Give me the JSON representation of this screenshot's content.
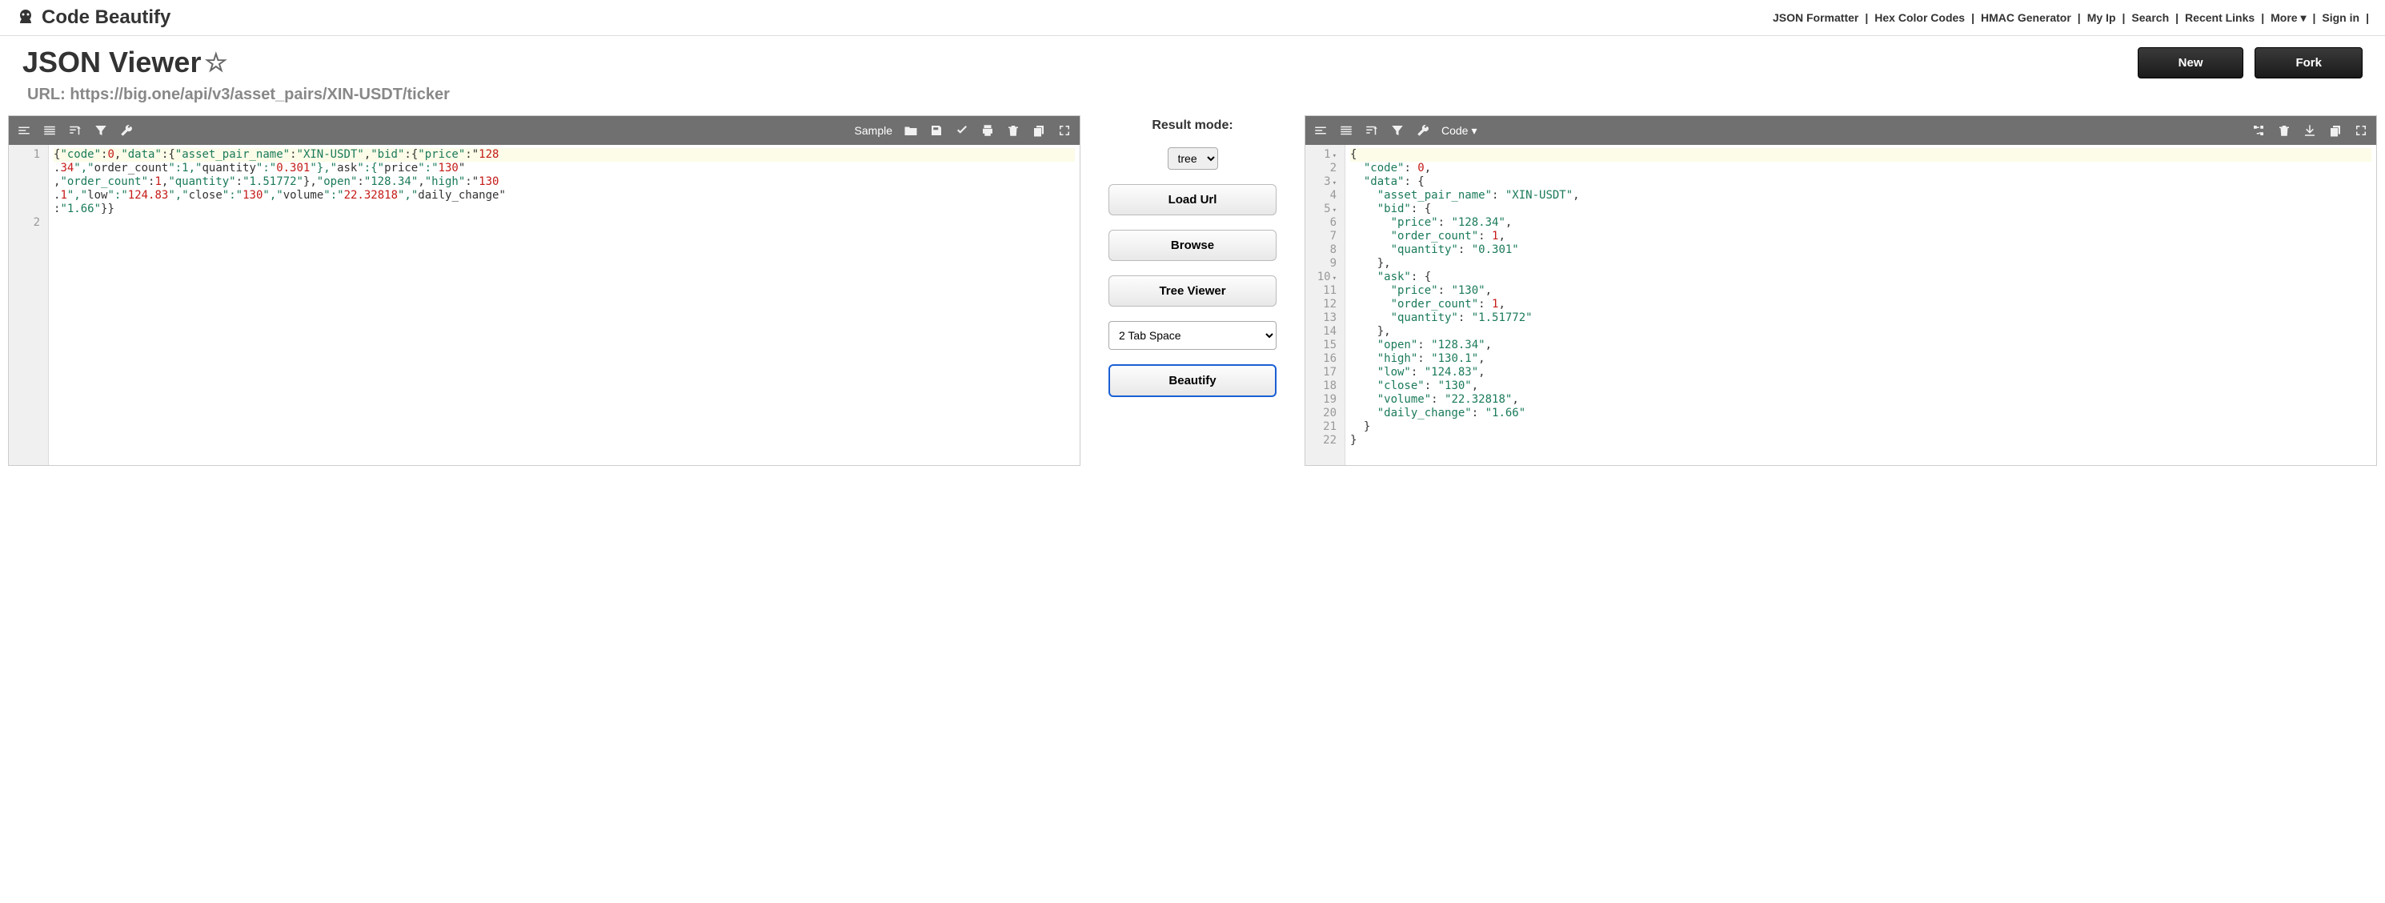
{
  "header": {
    "logo_text": "Code Beautify",
    "nav": [
      "JSON Formatter",
      "Hex Color Codes",
      "HMAC Generator",
      "My Ip",
      "Search",
      "Recent Links",
      "More",
      "Sign in"
    ]
  },
  "title": {
    "text": "JSON Viewer",
    "url_label": "URL: https://big.one/api/v3/asset_pairs/XIN-USDT/ticker",
    "new_btn": "New",
    "fork_btn": "Fork"
  },
  "center": {
    "result_mode_label": "Result mode:",
    "result_mode_value": "tree",
    "load_url": "Load Url",
    "browse": "Browse",
    "tree_viewer": "Tree Viewer",
    "indent": "2 Tab Space",
    "beautify": "Beautify"
  },
  "left_toolbar": {
    "sample": "Sample"
  },
  "right_toolbar": {
    "code": "Code"
  },
  "json_data": {
    "code": 0,
    "data": {
      "asset_pair_name": "XIN-USDT",
      "bid": {
        "price": "128.34",
        "order_count": 1,
        "quantity": "0.301"
      },
      "ask": {
        "price": "130",
        "order_count": 1,
        "quantity": "1.51772"
      },
      "open": "128.34",
      "high": "130.1",
      "low": "124.83",
      "close": "130",
      "volume": "22.32818",
      "daily_change": "1.66"
    }
  },
  "left_raw_lines": [
    "{\"code\":0,\"data\":{\"asset_pair_name\":\"XIN-USDT\",\"bid\":{\"price\":\"128",
    ".34\",\"order_count\":1,\"quantity\":\"0.301\"},\"ask\":{\"price\":\"130\"",
    ",\"order_count\":1,\"quantity\":\"1.51772\"},\"open\":\"128.34\",\"high\":\"130",
    ".1\",\"low\":\"124.83\",\"close\":\"130\",\"volume\":\"22.32818\",\"daily_change\"",
    ":\"1.66\"}}"
  ],
  "right_lines": [
    {
      "n": "1",
      "fold": true,
      "indent": 0,
      "tokens": [
        {
          "t": "punc",
          "v": "{"
        }
      ]
    },
    {
      "n": "2",
      "indent": 1,
      "tokens": [
        {
          "t": "key",
          "v": "\"code\""
        },
        {
          "t": "punc",
          "v": ": "
        },
        {
          "t": "num",
          "v": "0"
        },
        {
          "t": "punc",
          "v": ","
        }
      ]
    },
    {
      "n": "3",
      "fold": true,
      "indent": 1,
      "tokens": [
        {
          "t": "key",
          "v": "\"data\""
        },
        {
          "t": "punc",
          "v": ": {"
        }
      ]
    },
    {
      "n": "4",
      "indent": 2,
      "tokens": [
        {
          "t": "key",
          "v": "\"asset_pair_name\""
        },
        {
          "t": "punc",
          "v": ": "
        },
        {
          "t": "str",
          "v": "\"XIN-USDT\""
        },
        {
          "t": "punc",
          "v": ","
        }
      ]
    },
    {
      "n": "5",
      "fold": true,
      "indent": 2,
      "tokens": [
        {
          "t": "key",
          "v": "\"bid\""
        },
        {
          "t": "punc",
          "v": ": {"
        }
      ]
    },
    {
      "n": "6",
      "indent": 3,
      "tokens": [
        {
          "t": "key",
          "v": "\"price\""
        },
        {
          "t": "punc",
          "v": ": "
        },
        {
          "t": "str",
          "v": "\"128.34\""
        },
        {
          "t": "punc",
          "v": ","
        }
      ]
    },
    {
      "n": "7",
      "indent": 3,
      "tokens": [
        {
          "t": "key",
          "v": "\"order_count\""
        },
        {
          "t": "punc",
          "v": ": "
        },
        {
          "t": "num",
          "v": "1"
        },
        {
          "t": "punc",
          "v": ","
        }
      ]
    },
    {
      "n": "8",
      "indent": 3,
      "tokens": [
        {
          "t": "key",
          "v": "\"quantity\""
        },
        {
          "t": "punc",
          "v": ": "
        },
        {
          "t": "str",
          "v": "\"0.301\""
        }
      ]
    },
    {
      "n": "9",
      "indent": 2,
      "tokens": [
        {
          "t": "punc",
          "v": "},"
        }
      ]
    },
    {
      "n": "10",
      "fold": true,
      "indent": 2,
      "tokens": [
        {
          "t": "key",
          "v": "\"ask\""
        },
        {
          "t": "punc",
          "v": ": {"
        }
      ]
    },
    {
      "n": "11",
      "indent": 3,
      "tokens": [
        {
          "t": "key",
          "v": "\"price\""
        },
        {
          "t": "punc",
          "v": ": "
        },
        {
          "t": "str",
          "v": "\"130\""
        },
        {
          "t": "punc",
          "v": ","
        }
      ]
    },
    {
      "n": "12",
      "indent": 3,
      "tokens": [
        {
          "t": "key",
          "v": "\"order_count\""
        },
        {
          "t": "punc",
          "v": ": "
        },
        {
          "t": "num",
          "v": "1"
        },
        {
          "t": "punc",
          "v": ","
        }
      ]
    },
    {
      "n": "13",
      "indent": 3,
      "tokens": [
        {
          "t": "key",
          "v": "\"quantity\""
        },
        {
          "t": "punc",
          "v": ": "
        },
        {
          "t": "str",
          "v": "\"1.51772\""
        }
      ]
    },
    {
      "n": "14",
      "indent": 2,
      "tokens": [
        {
          "t": "punc",
          "v": "},"
        }
      ]
    },
    {
      "n": "15",
      "indent": 2,
      "tokens": [
        {
          "t": "key",
          "v": "\"open\""
        },
        {
          "t": "punc",
          "v": ": "
        },
        {
          "t": "str",
          "v": "\"128.34\""
        },
        {
          "t": "punc",
          "v": ","
        }
      ]
    },
    {
      "n": "16",
      "indent": 2,
      "tokens": [
        {
          "t": "key",
          "v": "\"high\""
        },
        {
          "t": "punc",
          "v": ": "
        },
        {
          "t": "str",
          "v": "\"130.1\""
        },
        {
          "t": "punc",
          "v": ","
        }
      ]
    },
    {
      "n": "17",
      "indent": 2,
      "tokens": [
        {
          "t": "key",
          "v": "\"low\""
        },
        {
          "t": "punc",
          "v": ": "
        },
        {
          "t": "str",
          "v": "\"124.83\""
        },
        {
          "t": "punc",
          "v": ","
        }
      ]
    },
    {
      "n": "18",
      "indent": 2,
      "tokens": [
        {
          "t": "key",
          "v": "\"close\""
        },
        {
          "t": "punc",
          "v": ": "
        },
        {
          "t": "str",
          "v": "\"130\""
        },
        {
          "t": "punc",
          "v": ","
        }
      ]
    },
    {
      "n": "19",
      "indent": 2,
      "tokens": [
        {
          "t": "key",
          "v": "\"volume\""
        },
        {
          "t": "punc",
          "v": ": "
        },
        {
          "t": "str",
          "v": "\"22.32818\""
        },
        {
          "t": "punc",
          "v": ","
        }
      ]
    },
    {
      "n": "20",
      "indent": 2,
      "tokens": [
        {
          "t": "key",
          "v": "\"daily_change\""
        },
        {
          "t": "punc",
          "v": ": "
        },
        {
          "t": "str",
          "v": "\"1.66\""
        }
      ]
    },
    {
      "n": "21",
      "indent": 1,
      "tokens": [
        {
          "t": "punc",
          "v": "}"
        }
      ]
    },
    {
      "n": "22",
      "indent": 0,
      "tokens": [
        {
          "t": "punc",
          "v": "}"
        }
      ]
    }
  ]
}
